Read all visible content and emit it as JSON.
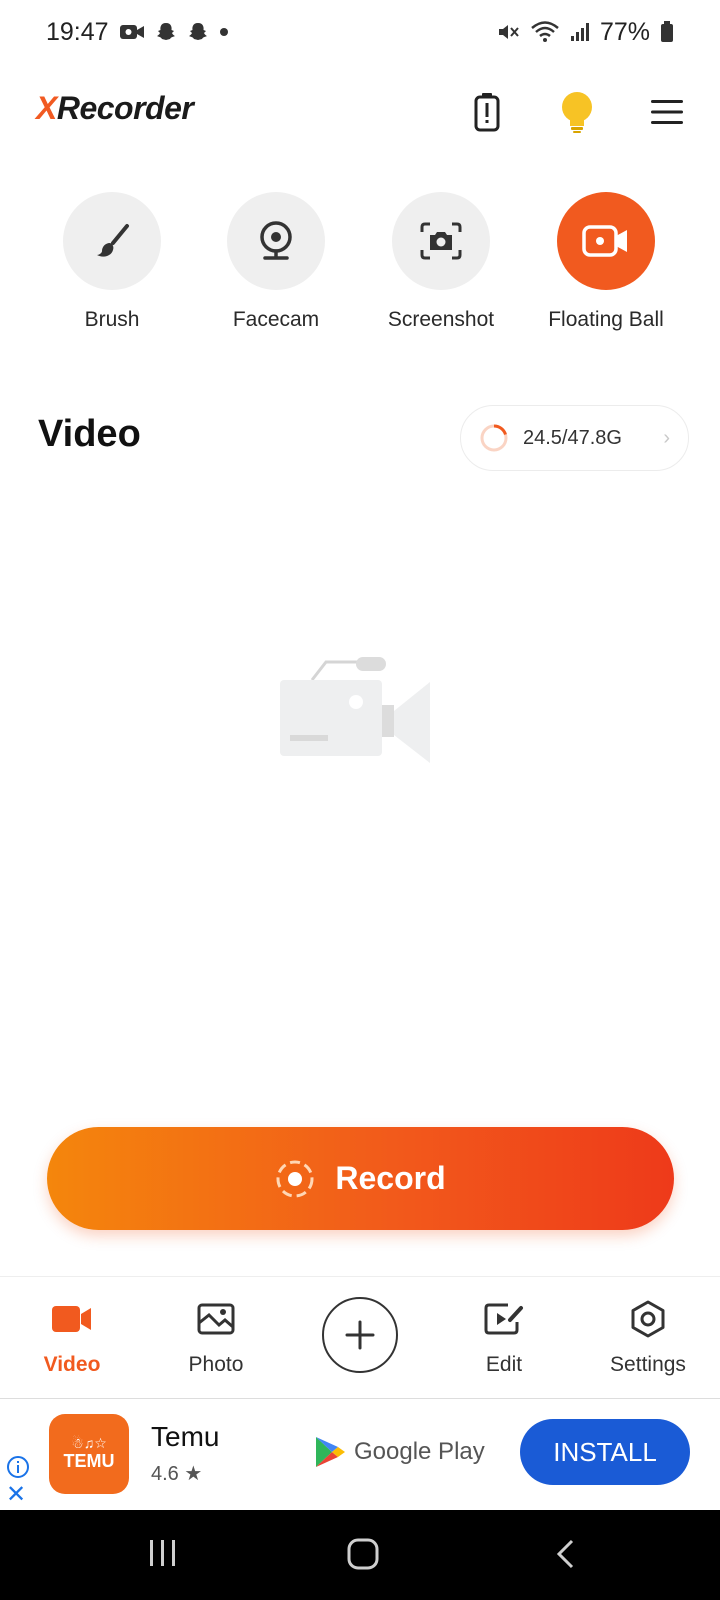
{
  "status_bar": {
    "time": "19:47",
    "battery": "77%",
    "icons": [
      "video-call-icon",
      "snapchat-icon",
      "snapchat-icon",
      "dot-icon",
      "mute-icon",
      "wifi-icon",
      "signal-icon",
      "battery-icon"
    ]
  },
  "header": {
    "logo_x": "X",
    "logo_rest": "Recorder",
    "icons": [
      "battery-alert-icon",
      "lightbulb-icon",
      "menu-icon"
    ]
  },
  "tools": [
    {
      "label": "Brush",
      "icon": "brush-icon"
    },
    {
      "label": "Facecam",
      "icon": "webcam-icon"
    },
    {
      "label": "Screenshot",
      "icon": "camera-icon"
    },
    {
      "label": "Floating Ball",
      "icon": "video-camera-icon",
      "active": true
    }
  ],
  "video_section": {
    "title": "Video",
    "storage": "24.5/47.8G"
  },
  "record_button": {
    "label": "Record"
  },
  "bottom_nav": [
    {
      "label": "Video",
      "icon": "video-icon",
      "active": true
    },
    {
      "label": "Photo",
      "icon": "photo-icon"
    },
    {
      "label": "",
      "icon": "add-icon"
    },
    {
      "label": "Edit",
      "icon": "edit-icon"
    },
    {
      "label": "Settings",
      "icon": "settings-icon"
    }
  ],
  "ad": {
    "app_icon_top": "☃♫☆",
    "app_icon_text": "TEMU",
    "app_name": "Temu",
    "rating": "4.6",
    "store": "Google Play",
    "install": "INSTALL"
  },
  "colors": {
    "accent": "#f15a1f",
    "install_blue": "#1a5bd6"
  }
}
